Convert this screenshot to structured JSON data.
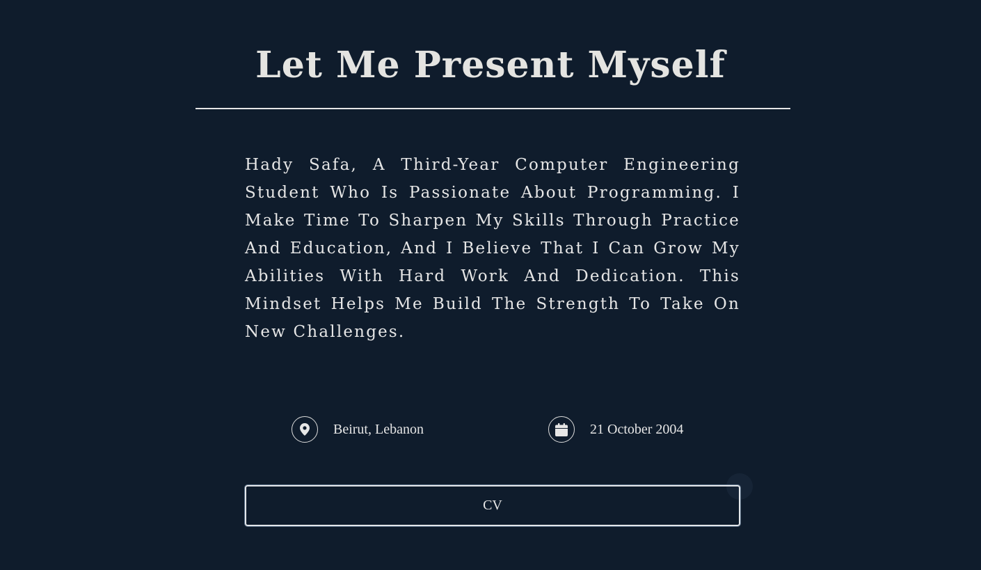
{
  "header": {
    "title": "Let Me Present Myself"
  },
  "about": {
    "bio": "Hady Safa, A Third-Year Computer Engineering Student Who Is Passionate About Programming. I Make Time To Sharpen My Skills Through Practice And Education, And I Believe That I Can Grow My Abilities With Hard Work And Dedication. This Mindset Helps Me Build The Strength To Take On New Challenges."
  },
  "info": {
    "location": {
      "icon": "map-pin-icon",
      "text": "Beirut, Lebanon"
    },
    "birthday": {
      "icon": "calendar-icon",
      "text": "21 October 2004"
    }
  },
  "actions": {
    "cv_label": "CV"
  },
  "colors": {
    "background": "#0f1c2c",
    "text": "#e6e6e6"
  }
}
